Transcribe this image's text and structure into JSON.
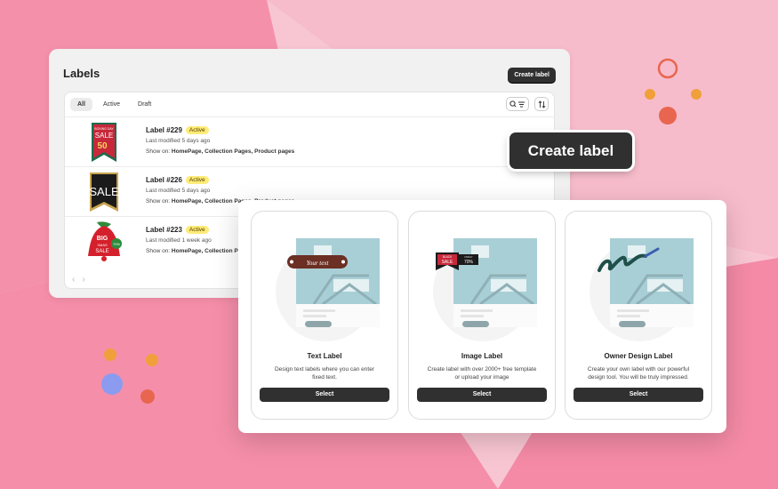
{
  "labels_panel": {
    "title": "Labels",
    "create_button": "Create label",
    "tabs": [
      {
        "label": "All",
        "selected": true
      },
      {
        "label": "Active",
        "selected": false
      },
      {
        "label": "Draft",
        "selected": false
      }
    ],
    "rows": [
      {
        "title": "Label #229",
        "status": "Active",
        "modified": "Last modified 5 days ago",
        "show_prefix": "Show on: ",
        "show_on": "HomePage, Collection Pages, Product pages",
        "thumb_text": {
          "top": "BOXING DAY",
          "mid": "SALE",
          "pct": "50"
        }
      },
      {
        "title": "Label #226",
        "status": "Active",
        "modified": "Last modified 5 days ago",
        "show_prefix": "Show on: ",
        "show_on": "HomePage, Collection Pages, Product pages",
        "thumb_text": {
          "mid": "SALE"
        }
      },
      {
        "title": "Label #223",
        "status": "Active",
        "modified": "Last modified 1 week ago",
        "show_prefix": "Show on: ",
        "show_on": "HomePage, Collection Pages, Product pages",
        "thumb_text": {
          "top": "BIG",
          "mid": "XMAS",
          "bot": "SALE",
          "pct": "70%"
        }
      }
    ]
  },
  "big_button": "Create label",
  "options": [
    {
      "title": "Text Label",
      "desc_line1": "Design text labels where you can enter",
      "desc_line2": "fixed text.",
      "button": "Select",
      "sample_text": "Your text"
    },
    {
      "title": "Image Label",
      "desc_line1": "Create label with over 2000+ free template",
      "desc_line2": "or upload your image",
      "button": "Select",
      "sample_black": "BLACK",
      "sample_friday": "FRIDAY",
      "sample_sale": "SALE",
      "sample_pct": "70%"
    },
    {
      "title": "Owner Design Label",
      "desc_line1": "Create your own label with our powerful",
      "desc_line2": "design tool. You will be truly impressed.",
      "button": "Select"
    }
  ],
  "colors": {
    "accent_dark": "#303030",
    "badge_yellow": "#ffeb78",
    "bg_pink": "#f6b3c3"
  }
}
